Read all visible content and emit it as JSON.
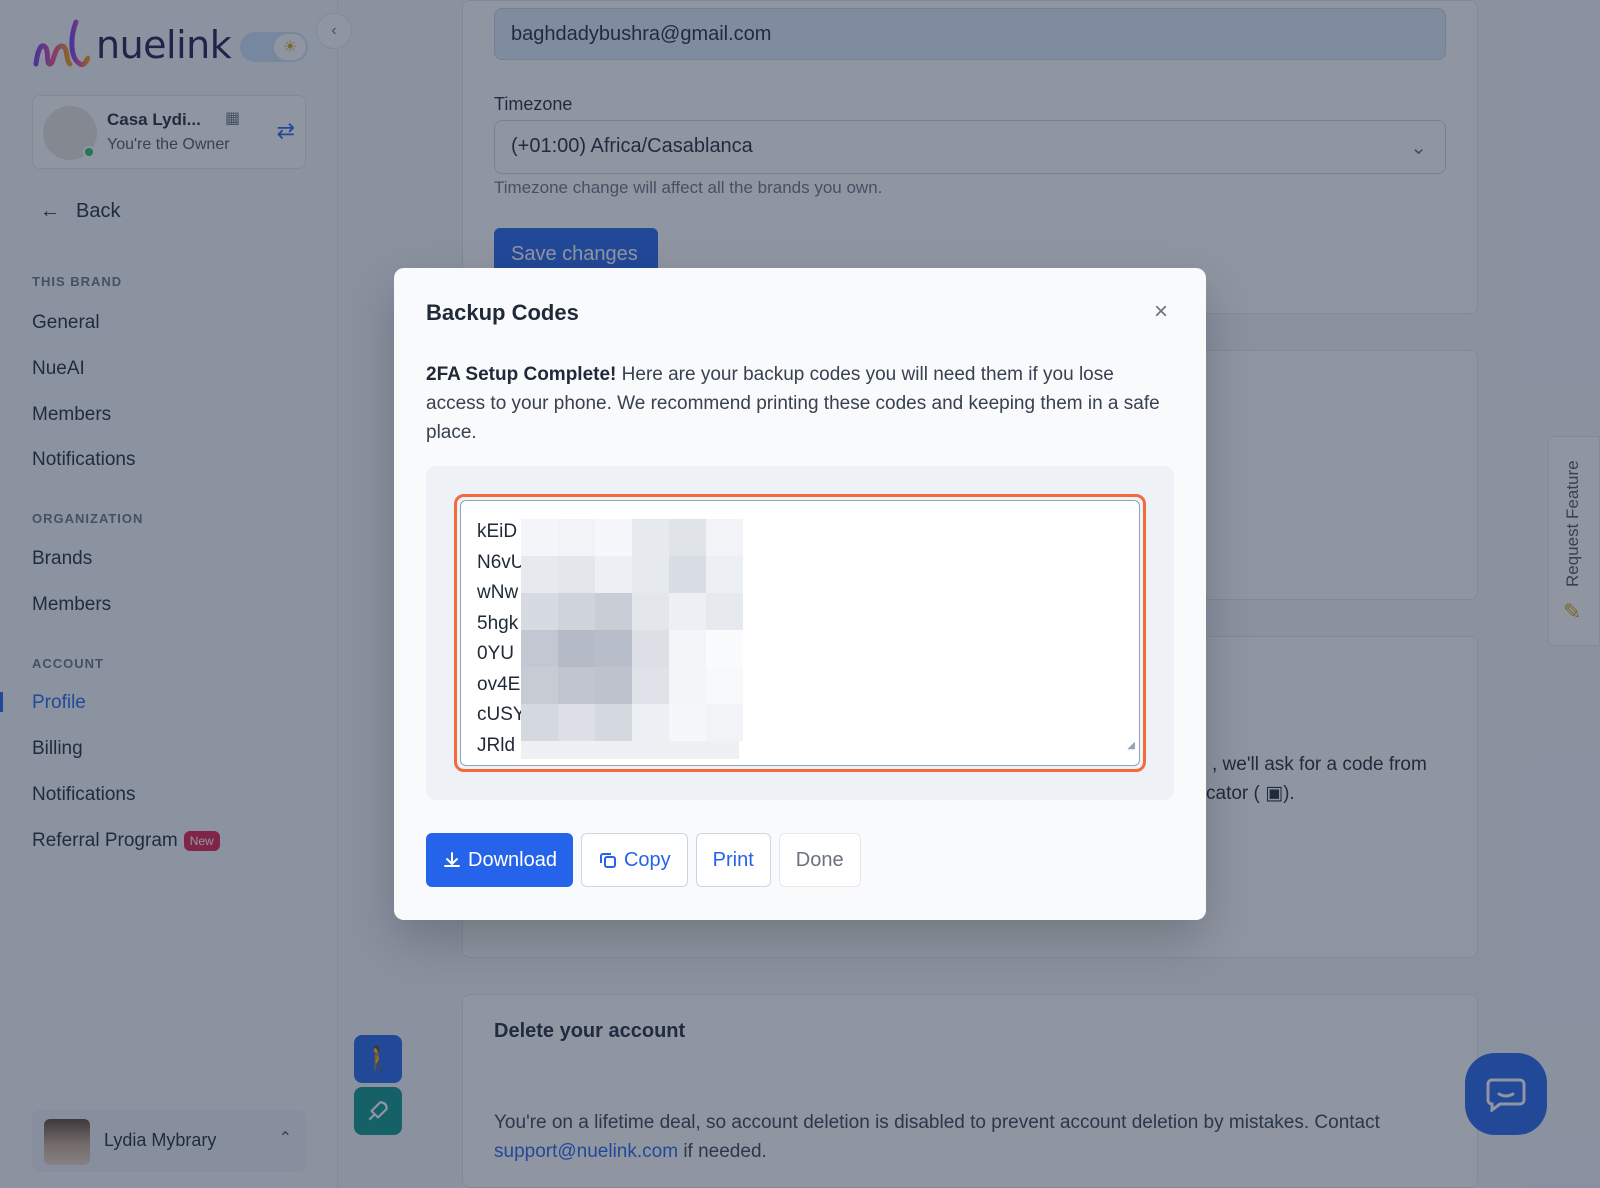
{
  "sidebar": {
    "logo_text": "nuelink",
    "brand": {
      "name": "Casa Lydi...",
      "role": "You're the Owner"
    },
    "back_label": "Back",
    "sections": {
      "this_brand": "THIS BRAND",
      "organization": "ORGANIZATION",
      "account": "ACCOUNT"
    },
    "this_brand_items": [
      "General",
      "NueAI",
      "Members",
      "Notifications"
    ],
    "organization_items": [
      "Brands",
      "Members"
    ],
    "account_items": [
      "Profile",
      "Billing",
      "Notifications",
      "Referral Program"
    ],
    "referral_badge": "New",
    "active_item": "Profile",
    "user_name": "Lydia Mybrary"
  },
  "main": {
    "email_value": "baghdadybushra@gmail.com",
    "timezone_label": "Timezone",
    "timezone_value": "(+01:00) Africa/Casablanca",
    "timezone_hint": "Timezone change will affect all the brands you own.",
    "save_label": "Save changes",
    "partial_2fa_line1": ", we'll ask for a code from",
    "partial_2fa_line2": "cator (",
    "partial_2fa_line2_end": ").",
    "delete_title": "Delete your account",
    "delete_text": "You're on a lifetime deal, so account deletion is disabled to prevent account deletion by mistakes. Contact",
    "delete_link": "support@nuelink.com",
    "delete_suffix": " if needed."
  },
  "request_feature_label": "Request Feature",
  "modal": {
    "title": "Backup Codes",
    "desc_bold": "2FA Setup Complete!",
    "desc_rest": " Here are your backup codes you will need them if you lose access to your phone. We recommend printing these codes and keeping them in a safe place.",
    "codes": [
      "kEiD",
      "N6vU",
      "wNw",
      "5hgk",
      "0YU",
      "ov4E",
      "cUSY",
      "JRld"
    ],
    "buttons": {
      "download": "Download",
      "copy": "Copy",
      "print": "Print",
      "done": "Done"
    }
  },
  "colors": {
    "accent": "#2563eb",
    "highlight_border": "#f26b3a",
    "badge": "#e11d48"
  }
}
